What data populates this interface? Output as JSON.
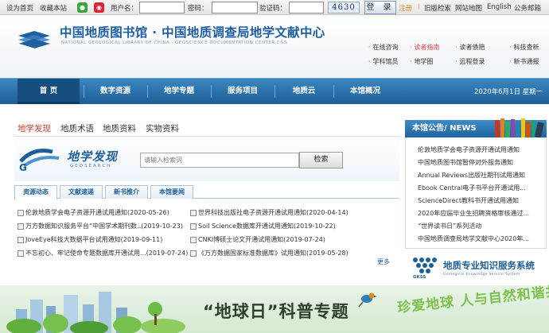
{
  "topbar": {
    "set_home": "设为首页",
    "favorite": "收藏本站",
    "username_label": "用户名：",
    "password_label": "密码：",
    "captcha_label": "验证码：",
    "captcha_value": "4630",
    "login": "登 录",
    "register": "注册",
    "old_version": "旧版检索",
    "sitemap": "网站地图",
    "english": "English",
    "mail": "公务邮箱"
  },
  "header": {
    "title": "中国地质图书馆 · 中国地质调查局地学文献中心",
    "subtitle": "NATIONAL GEOLOGICAL LIBRARY OF CHINA · GEOSCIENCE DOCUMENTATION CENTER,CGS",
    "quick_links": [
      "在线咨询",
      "读者指南",
      "读者债赔",
      "科技查新",
      "学科馆员",
      "地学圈",
      "远程登录",
      "新书通报"
    ]
  },
  "nav": {
    "items": [
      "首 页",
      "数字资源",
      "地学专题",
      "服务项目",
      "地质云",
      "本馆概况"
    ],
    "date": "2020年6月1日 星期一"
  },
  "search": {
    "tabs": [
      "地学发现",
      "地质术语",
      "地质资料",
      "实物资料"
    ],
    "brand_cn": "地学发现",
    "brand_en": "GEOSEARCH",
    "placeholder": "请输入检索词",
    "button": "检索"
  },
  "news": {
    "tabs": [
      "资源动态",
      "文献速递",
      "新书推介",
      "本馆要闻"
    ],
    "items_left": [
      "伦敦地质学会电子资源开通试用通知(2020-05-26)",
      "万方数据知识服务平台“中国学术期刊数..(2019-10-23)",
      "JoveEye科技大数据平台试用通知(2019-09-11)",
      "不忘初心、牢记使命专题数据库开通试用...(2019-07-24)"
    ],
    "items_right": [
      "世界科技出版社电子资源开通试用通知(2020-04-14)",
      "Soil Science数据库开通试用通知(2019-10-22)",
      "CNKI博硕士论文开通试用通知(2019-07-24)",
      "《万方数据国家标准数据库》试用通知(2019-05-28)"
    ],
    "more": "更多"
  },
  "notice": {
    "title": "本馆公告/ NEWS",
    "items": [
      "伦敦地质学会电子资源开通试用通知",
      "中国地质图书馆暂停对外服务通知",
      "Annual Reviews出版社期刊试用通知",
      "Ebook Central电子书平台开通试用...",
      "ScienceDirect教科书开通试用通知",
      "2020年应届毕业生招聘资格审核通过...",
      "“世界读书日”系列活动",
      "中国地质调查局地学文献中心2020年..."
    ]
  },
  "gks": {
    "title": "地质专业知识服务系统",
    "subtitle": "Geological Knowledge Service System",
    "abbr": "GKSS"
  },
  "banner": {
    "title": "“地球日”科普专题",
    "slogan": "珍爱地球 人与自然和谐共生"
  },
  "colors": {
    "nav_blue": "#1d5f97",
    "accent_red": "#c0392b",
    "tab_active": "#c0392b"
  }
}
